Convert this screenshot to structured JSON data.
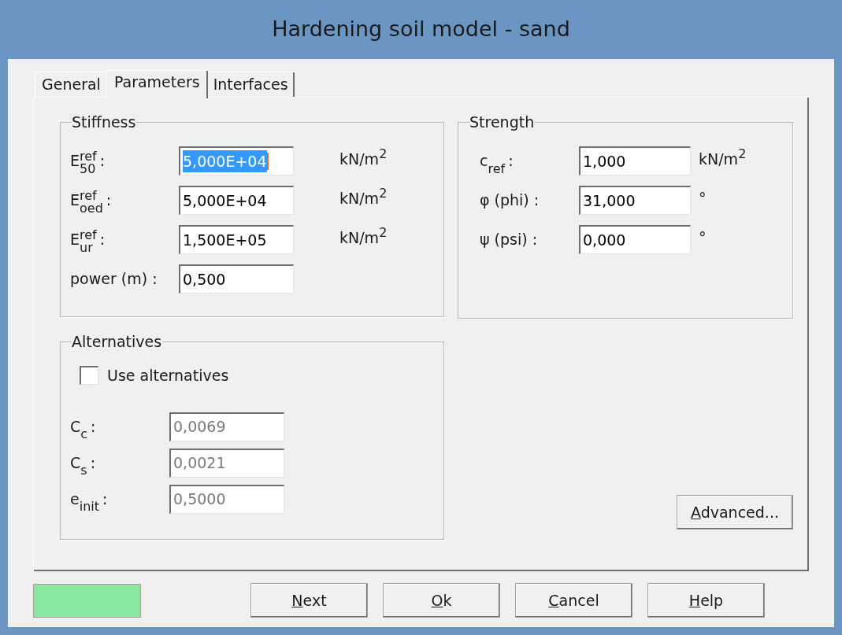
{
  "window": {
    "title": "Hardening soil model - sand"
  },
  "tabs": [
    {
      "label": "General",
      "selected": false
    },
    {
      "label": "Parameters",
      "selected": true
    },
    {
      "label": "Interfaces",
      "selected": false
    }
  ],
  "stiffness": {
    "title": "Stiffness",
    "rows": [
      {
        "symbol": "E",
        "sup": "ref",
        "sub": "50",
        "tail": ":",
        "value": "5,000E+04",
        "unit": "kN/m",
        "unit_sup": "2",
        "focused": true
      },
      {
        "symbol": "E",
        "sup": "ref",
        "sub": "oed",
        "tail": ":",
        "value": "5,000E+04",
        "unit": "kN/m",
        "unit_sup": "2",
        "focused": false
      },
      {
        "symbol": "E",
        "sup": "ref",
        "sub": "ur",
        "tail": ":",
        "value": "1,500E+05",
        "unit": "kN/m",
        "unit_sup": "2",
        "focused": false
      },
      {
        "symbol": "power (m) :",
        "value": "0,500",
        "focused": false
      }
    ]
  },
  "strength": {
    "title": "Strength",
    "rows": [
      {
        "symbol": "c",
        "sub": "ref",
        "tail": ":",
        "value": "1,000",
        "unit": "kN/m",
        "unit_sup": "2"
      },
      {
        "symbol": "φ (phi) :",
        "value": "31,000",
        "unit": "°"
      },
      {
        "symbol": "ψ (psi) :",
        "value": "0,000",
        "unit": "°"
      }
    ]
  },
  "alternatives": {
    "title": "Alternatives",
    "checkbox": {
      "label": "Use alternatives",
      "checked": false
    },
    "rows": [
      {
        "symbol": "C",
        "sub": "c",
        "tail": ":",
        "value": "0,0069",
        "disabled": true
      },
      {
        "symbol": "C",
        "sub": "s",
        "tail": ":",
        "value": "0,0021",
        "disabled": true
      },
      {
        "symbol": "e",
        "sub": "init",
        "tail": ":",
        "value": "0,5000",
        "disabled": true
      }
    ]
  },
  "advanced_button": {
    "label": "Advanced...",
    "mnemonic": true
  },
  "status_swatch": {
    "color": "#88e8a0"
  },
  "buttons": [
    {
      "label": "Next",
      "mnemonic": true
    },
    {
      "label": "Ok",
      "mnemonic": true
    },
    {
      "label": "Cancel",
      "mnemonic": true
    },
    {
      "label": "Help",
      "mnemonic": true
    }
  ]
}
